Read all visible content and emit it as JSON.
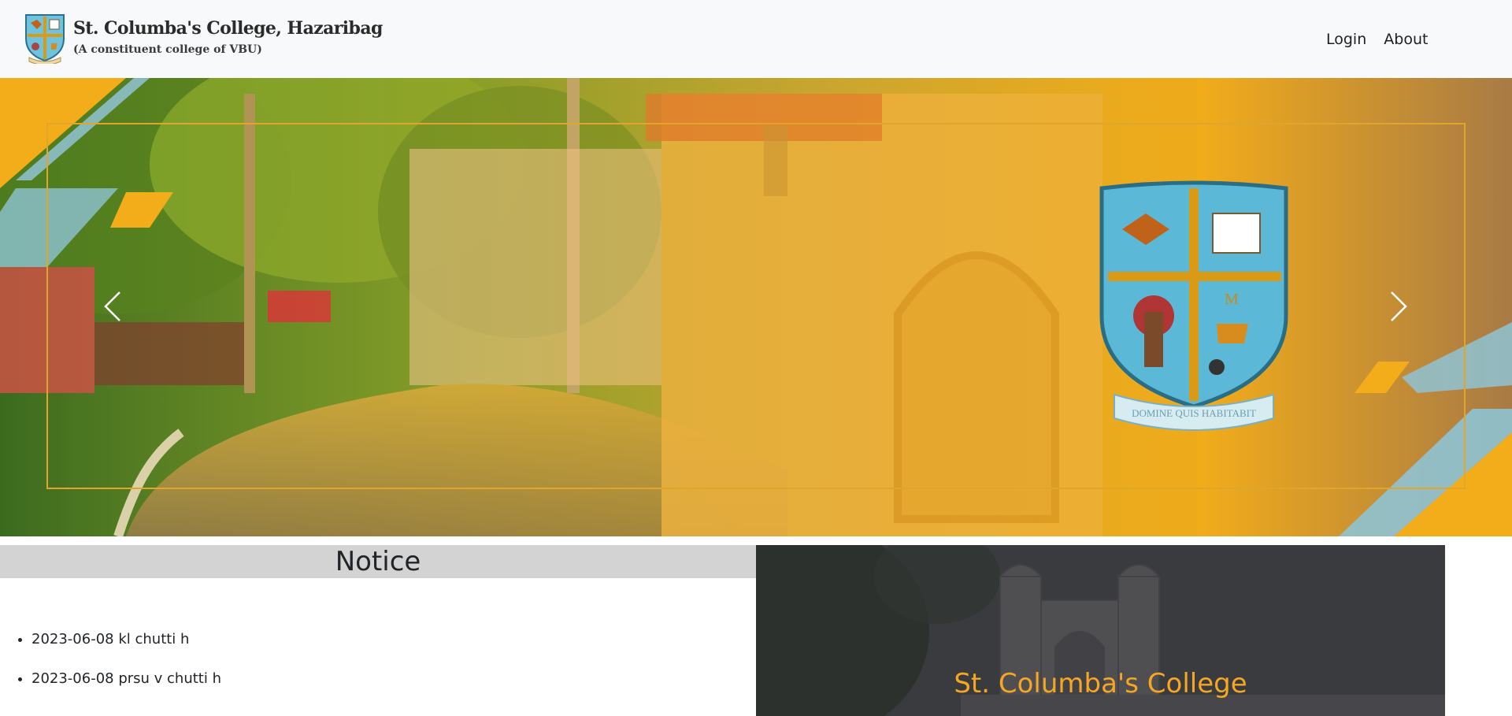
{
  "navbar": {
    "brand_title": "St. Columba's College, Hazaribag",
    "brand_subtitle": "(A constituent college of VBU)",
    "logo_icon": "college-crest-icon",
    "links": [
      {
        "label": "Login"
      },
      {
        "label": "About"
      }
    ]
  },
  "hero": {
    "prev_icon": "chevron-left-icon",
    "next_icon": "chevron-right-icon",
    "crest_motto": "DOMINE QUIS HABITABIT",
    "crest_letter": "M",
    "accent_color": "#f3ad1a",
    "stripe_color": "#8fc3d3"
  },
  "notice": {
    "title": "Notice",
    "items": [
      {
        "text": "2023-06-08 kl chutti h"
      },
      {
        "text": "2023-06-08 prsu v chutti h"
      }
    ]
  },
  "college_panel": {
    "title": "St. Columba's College",
    "title_color": "#f5a623"
  }
}
